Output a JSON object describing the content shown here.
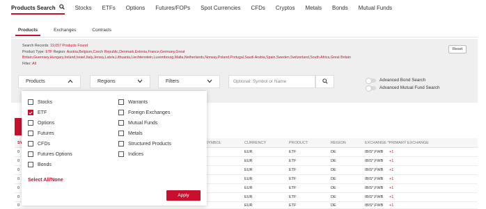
{
  "topnav": {
    "items": [
      "Products Search",
      "Stocks",
      "ETFs",
      "Options",
      "Futures/FOPs",
      "Spot Currencies",
      "CFDs",
      "Cryptos",
      "Metals",
      "Bonds",
      "Mutual Funds"
    ]
  },
  "subtabs": [
    "Products",
    "Exchanges",
    "Contracts"
  ],
  "summary": {
    "records_label": "Search Records:",
    "records_value": "19,057 Products Found",
    "type_label": "Product Type:",
    "type_value": "ETF",
    "region_label": "Region:",
    "region_value_1": "Austria,Belgium,Czech Republic,Denmark,Estonia,France,Germany,Great",
    "region_value_2": "Britain,Guernsey,Hungary,Ireland,Israel,Italy,Jersey,Latvia,Lithuania,Liechtenstein,Luxembourg,Malta,Netherlands,Norway,Poland,Portugal,Saudi Arabia,Spain,Sweden,Switzerland,South Africa,Great Britain",
    "filter_label": "Filter:",
    "filter_value": "All"
  },
  "reset_label": "Reset",
  "dropdowns": {
    "products": "Products",
    "regions": "Regions",
    "filters": "Filters"
  },
  "symbol_placeholder": "Optional: Symbol or Name",
  "toggles": [
    "Advanced Bond Search",
    "Advanced Mutual Fund Search"
  ],
  "table": {
    "headers": [
      "SY",
      "SYMBOL",
      "CURRENCY",
      "PRODUCT",
      "REGION",
      "EXCHANGE *PRIMARY EXCHANGE"
    ],
    "rows": [
      {
        "c0": "0",
        "currency": "EUR",
        "product": "ETF",
        "region": "DE",
        "exchange": "IBIS*,FWB",
        "more": "+1"
      },
      {
        "c0": "0",
        "currency": "EUR",
        "product": "ETF",
        "region": "DE",
        "exchange": "IBIS*,FWB",
        "more": "+1"
      },
      {
        "c0": "0",
        "currency": "EUR",
        "product": "ETF",
        "region": "DE",
        "exchange": "IBIS*,FWB",
        "more": "+1"
      },
      {
        "c0": "0",
        "currency": "EUR",
        "product": "ETF",
        "region": "DE",
        "exchange": "IBIS*,FWB",
        "more": "+1"
      },
      {
        "c0": "0",
        "currency": "EUR",
        "product": "ETF",
        "region": "DE",
        "exchange": "IBIS*,FWB",
        "more": "+1"
      },
      {
        "c0": "0",
        "currency": "EUR",
        "product": "ETF",
        "region": "DE",
        "exchange": "IBIS*,FWB",
        "more": "+1"
      },
      {
        "c0": "0",
        "currency": "EUR",
        "product": "ETF",
        "region": "DE",
        "exchange": "IBIS*,FWB",
        "more": "+1"
      }
    ]
  },
  "product_options": {
    "left": [
      {
        "label": "Stocks",
        "checked": false
      },
      {
        "label": "ETF",
        "checked": true
      },
      {
        "label": "Options",
        "checked": false
      },
      {
        "label": "Futures",
        "checked": false
      },
      {
        "label": "CFDs",
        "checked": false
      },
      {
        "label": "Futures Options",
        "checked": false
      },
      {
        "label": "Bonds",
        "checked": false
      }
    ],
    "right": [
      {
        "label": "Warrants",
        "checked": false
      },
      {
        "label": "Foreign Exchanges",
        "checked": false
      },
      {
        "label": "Mutual Funds",
        "checked": false
      },
      {
        "label": "Metals",
        "checked": false
      },
      {
        "label": "Structured Products",
        "checked": false
      },
      {
        "label": "Indices",
        "checked": false
      }
    ]
  },
  "select_all_label": "Select All/None",
  "apply_label": "Apply",
  "colors": {
    "accent": "#c8102e",
    "panel": "#efefef"
  }
}
